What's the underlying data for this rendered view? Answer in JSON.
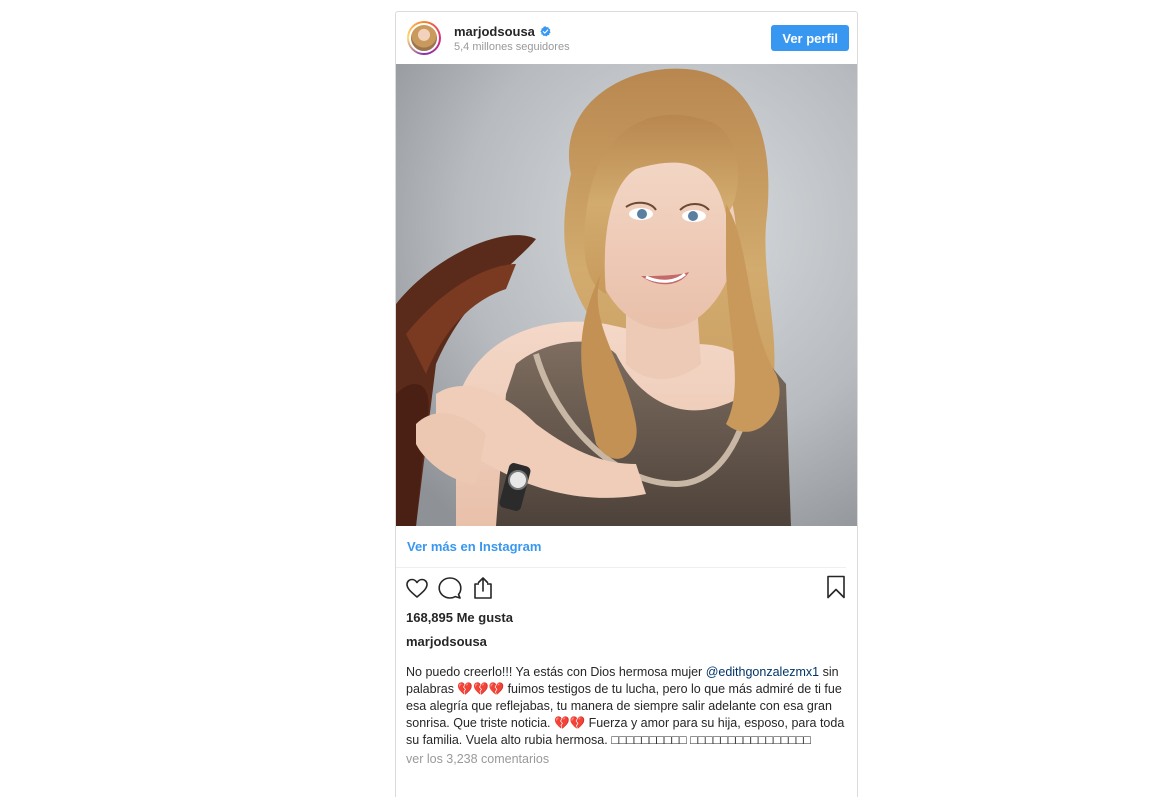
{
  "profile": {
    "username": "marjodsousa",
    "followers": "5,4 millones seguidores",
    "view_profile_button": "Ver perfil"
  },
  "post": {
    "view_more_link": "Ver más en Instagram",
    "likes": "168,895 Me gusta",
    "caption_username": "marjodsousa",
    "caption_part1": "No puedo creerlo!!! Ya estás con Dios hermosa mujer ",
    "caption_mention": "@edithgonzalezmx1",
    "caption_part2": " sin palabras 💔💔💔 fuimos testigos de tu lucha, pero lo que más admiré de ti fue esa alegría que reflejabas, tu manera de siempre salir adelante con esa gran sonrisa. Que triste noticia. 💔💔 Fuerza y amor para su hija, esposo, para toda su familia. Vuela alto rubia hermosa. □□□□□□□□□□ □□□□□□□□□□□□□□□□",
    "comments_link": "ver los 3,238 comentarios"
  },
  "icons": {
    "avatar": "avatar",
    "verified": "verified-badge-icon",
    "like": "heart-icon",
    "comment": "comment-icon",
    "share": "share-icon",
    "save": "bookmark-icon"
  },
  "colors": {
    "accent": "#3897f0",
    "mention": "#003569",
    "muted": "#999999",
    "border": "#dbdbdb"
  }
}
